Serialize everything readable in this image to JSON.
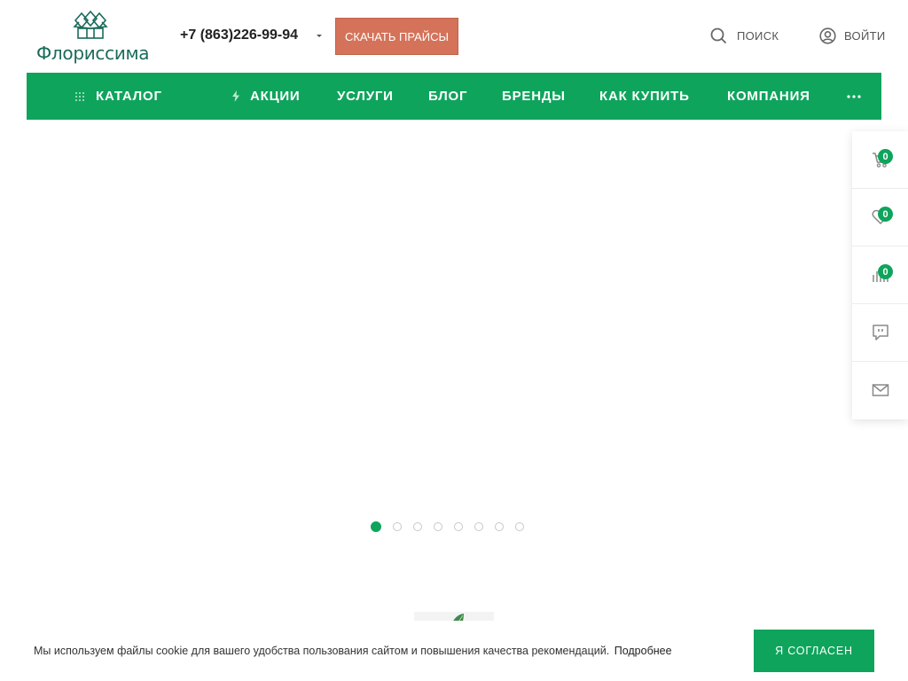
{
  "header": {
    "logo_text": "Флориссима",
    "phone": "+7 (863)226-99-94",
    "price_button": "СКАЧАТЬ ПРАЙСЫ",
    "search_label": "ПОИСК",
    "login_label": "ВОЙТИ"
  },
  "nav": {
    "items": [
      {
        "label": "КАТАЛОГ",
        "icon": "grid-icon"
      },
      {
        "label": "АКЦИИ",
        "icon": "lightning-icon"
      },
      {
        "label": "УСЛУГИ"
      },
      {
        "label": "БЛОГ"
      },
      {
        "label": "БРЕНДЫ"
      },
      {
        "label": "КАК КУПИТЬ"
      },
      {
        "label": "КОМПАНИЯ"
      }
    ],
    "more_icon": "more-dots-icon"
  },
  "slider": {
    "dot_count": 8,
    "active_index": 0
  },
  "side_panel": {
    "cart_count": "0",
    "favorites_count": "0",
    "compare_count": "0"
  },
  "cookie": {
    "text": "Мы используем файлы cookie для вашего удобства пользования сайтом и повышения качества рекомендаций.",
    "more_link": "Подробнее",
    "agree_button": "Я СОГЛАСЕН"
  },
  "colors": {
    "brand_green": "#0fa45c",
    "price_button": "#d4735a",
    "logo_teal": "#1b6b5a"
  }
}
